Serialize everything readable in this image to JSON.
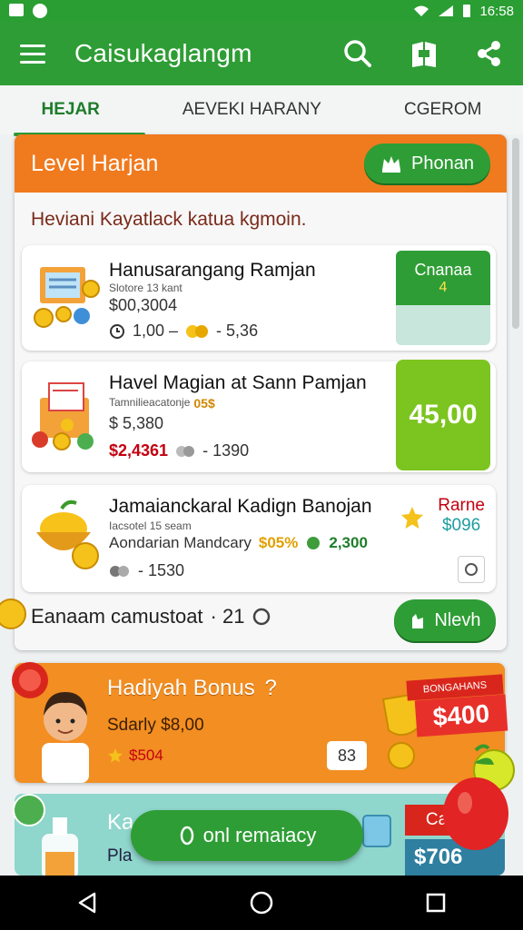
{
  "status_bar": {
    "time": "16:58"
  },
  "app_bar": {
    "title": "Caisukaglangm"
  },
  "tabs": [
    {
      "label": "HEJAR"
    },
    {
      "label": "AEVEKI HARANY"
    },
    {
      "label": "CGEROM"
    }
  ],
  "level_card": {
    "title": "Level Harjan",
    "action_label": "Phonan",
    "subtitle": "Heviani Kayatlack katua kgmoin.",
    "offers": [
      {
        "title": "Hanusarangang Ramjan",
        "small": "Slotore 13 kant",
        "amount": "$00,3004",
        "meta_a": "1,00 –",
        "meta_b": "- 5,36",
        "badge_title": "Cnanaa",
        "badge_sub": "4"
      },
      {
        "title": "Havel Magian at Sann Pamjan",
        "small": "Tamnilieacatonje",
        "small_b": "05$",
        "amount": "$ 5,380",
        "meta_a": "$2,4361",
        "meta_b": "- 1390",
        "badge_value": "45,00"
      },
      {
        "title": "Jamaianckaral Kadign Banojan",
        "small": "Iacsotel 15 seam",
        "amount": "Aondarian Mandcary",
        "amount_b": "$05%",
        "amount_c": "2,300",
        "meta_a": "- 1530",
        "badge_title": "Rarne",
        "badge_value": "$096"
      }
    ],
    "earn_text": "Eanaam camustoat",
    "earn_value": "· 21",
    "next_label": "Nlevh"
  },
  "bonus_card": {
    "title": "Hadiyah Bonus",
    "title_mark": "?",
    "subtitle": "Sdarly $8,00",
    "value": "$504",
    "badge": "83",
    "tag_title": "BONGAHANS",
    "tag_value": "$400"
  },
  "bottom_card": {
    "title": "Ka",
    "sub": "Pla",
    "tag_title": "Ca",
    "tag_value": "$706"
  },
  "floating_button": {
    "label": "onl remaiacy"
  },
  "colors": {
    "primary": "#2e9d35",
    "accent": "#f07a1e",
    "bonus": "#f28e22"
  },
  "icons": [
    "menu-icon",
    "search-icon",
    "book-icon",
    "share-icon",
    "crown-icon",
    "back-icon",
    "home-icon",
    "recents-icon"
  ]
}
